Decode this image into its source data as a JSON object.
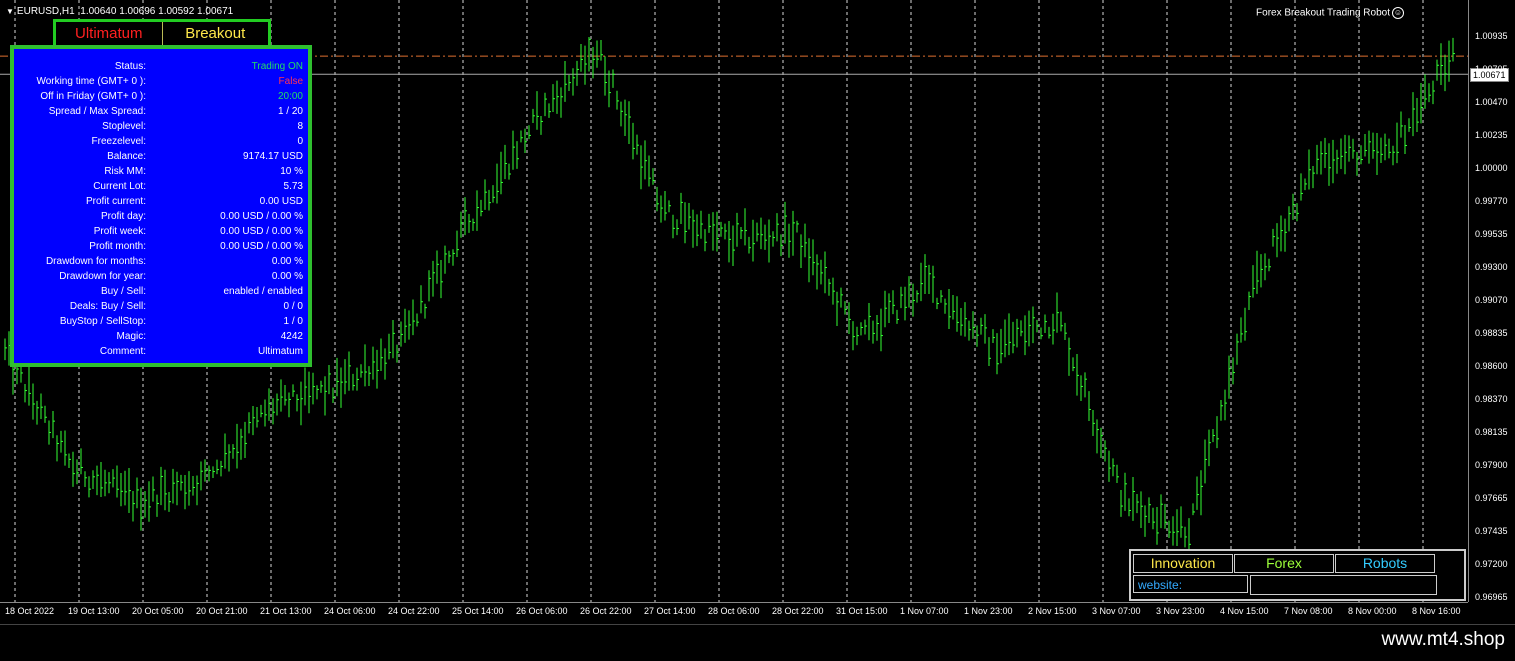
{
  "symbol": {
    "title": "EURUSD,H1",
    "ohlc": "1.00640 1.00696 1.00592 1.00671"
  },
  "robot_title": "Forex Breakout Trading Robot",
  "mode_tabs": [
    "Ultimatum",
    "Breakout"
  ],
  "panel": {
    "rows": [
      {
        "label": "Status:",
        "value": "Trading ON",
        "color": "#22dd66"
      },
      {
        "label": "Working time (GMT+ 0 ):",
        "value": "False",
        "color": "#ff3355"
      },
      {
        "label": "Off in Friday (GMT+ 0 ):",
        "value": "20:00",
        "color": "#22dd66"
      },
      {
        "label": "Spread / Max Spread:",
        "value": "1 / 20",
        "color": "#ffffff"
      },
      {
        "label": "Stoplevel:",
        "value": "8",
        "color": "#ffffff"
      },
      {
        "label": "Freezelevel:",
        "value": "0",
        "color": "#ffffff"
      },
      {
        "label": "Balance:",
        "value": "9174.17 USD",
        "color": "#ffffff"
      },
      {
        "label": "Risk MM:",
        "value": "10 %",
        "color": "#ffffff"
      },
      {
        "label": "Current Lot:",
        "value": "5.73",
        "color": "#ffffff"
      },
      {
        "label": "Profit current:",
        "value": "0.00 USD",
        "color": "#ffffff"
      },
      {
        "label": "Profit day:",
        "value": "0.00 USD / 0.00 %",
        "color": "#ffffff"
      },
      {
        "label": "Profit week:",
        "value": "0.00 USD / 0.00 %",
        "color": "#ffffff"
      },
      {
        "label": "Profit month:",
        "value": "0.00 USD / 0.00 %",
        "color": "#ffffff"
      },
      {
        "label": "Drawdown for months:",
        "value": "0.00 %",
        "color": "#ffffff"
      },
      {
        "label": "Drawdown for year:",
        "value": "0.00 %",
        "color": "#ffffff"
      },
      {
        "label": "Buy  /  Sell:",
        "value": "enabled  /  enabled",
        "color": "#ffffff"
      },
      {
        "label": "Deals: Buy / Sell:",
        "value": "0  /  0",
        "color": "#ffffff"
      },
      {
        "label": "BuyStop / SellStop:",
        "value": "1  /  0",
        "color": "#ffffff"
      },
      {
        "label": "Magic:",
        "value": "4242",
        "color": "#ffffff"
      },
      {
        "label": "Comment:",
        "value": "Ultimatum",
        "color": "#ffffff"
      }
    ]
  },
  "price_axis": [
    "1.00935",
    "1.00705",
    "1.00470",
    "1.00235",
    "1.00000",
    "0.99770",
    "0.99535",
    "0.99300",
    "0.99070",
    "0.98835",
    "0.98600",
    "0.98370",
    "0.98135",
    "0.97900",
    "0.97665",
    "0.97435",
    "0.97200",
    "0.96965"
  ],
  "current_price": "1.00671",
  "time_axis": [
    "18 Oct 2022",
    "19 Oct 13:00",
    "20 Oct 05:00",
    "20 Oct 21:00",
    "21 Oct 13:00",
    "24 Oct 06:00",
    "24 Oct 22:00",
    "25 Oct 14:00",
    "26 Oct 06:00",
    "26 Oct 22:00",
    "27 Oct 14:00",
    "28 Oct 06:00",
    "28 Oct 22:00",
    "31 Oct 15:00",
    "1 Nov 07:00",
    "1 Nov 23:00",
    "2 Nov 15:00",
    "3 Nov 07:00",
    "3 Nov 23:00",
    "4 Nov 15:00",
    "7 Nov 08:00",
    "8 Nov 00:00",
    "8 Nov 16:00"
  ],
  "links": {
    "items": [
      "Innovation",
      "Forex",
      "Robots"
    ],
    "website_label": "website:"
  },
  "watermark": "www.mt4.shop",
  "chart_data": {
    "type": "line",
    "series_color": "#33ff33",
    "y_range": [
      0.96965,
      1.00935
    ],
    "current_price": 1.00671,
    "order_level": 1.008,
    "x": [
      "18 Oct 2022",
      "19 Oct 13:00",
      "20 Oct 05:00",
      "20 Oct 21:00",
      "21 Oct 13:00",
      "24 Oct 06:00",
      "24 Oct 22:00",
      "25 Oct 14:00",
      "26 Oct 06:00",
      "26 Oct 22:00",
      "27 Oct 14:00",
      "28 Oct 06:00",
      "28 Oct 22:00",
      "31 Oct 15:00",
      "1 Nov 07:00",
      "1 Nov 23:00",
      "2 Nov 15:00",
      "3 Nov 07:00",
      "3 Nov 23:00",
      "4 Nov 15:00",
      "7 Nov 08:00",
      "8 Nov 00:00",
      "8 Nov 16:00"
    ],
    "values": [
      0.987,
      0.979,
      0.9765,
      0.978,
      0.983,
      0.9845,
      0.9875,
      0.996,
      1.003,
      1.0085,
      0.997,
      0.995,
      0.9955,
      0.988,
      0.992,
      0.9875,
      0.9895,
      0.9765,
      0.9745,
      0.992,
      1.001,
      1.001,
      1.008
    ]
  }
}
